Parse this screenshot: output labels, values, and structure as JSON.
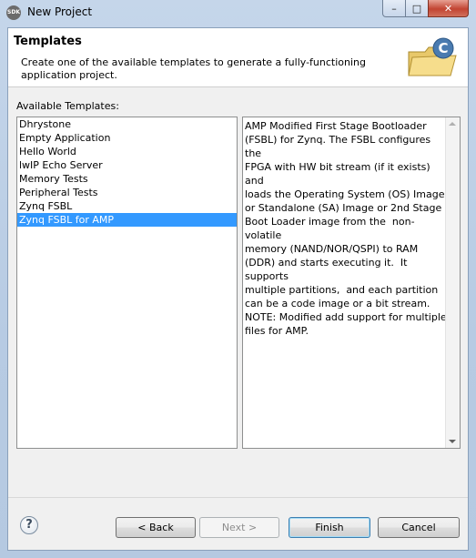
{
  "window": {
    "title": "New Project",
    "icon_label": "SDK"
  },
  "header": {
    "title": "Templates",
    "description": "Create one of the available templates to generate a fully-functioning application project."
  },
  "templates": {
    "label": "Available Templates:",
    "items": [
      "Dhrystone",
      "Empty Application",
      "Hello World",
      "lwIP Echo Server",
      "Memory Tests",
      "Peripheral Tests",
      "Zynq FSBL",
      "Zynq FSBL for AMP"
    ],
    "selected": "Zynq FSBL for AMP"
  },
  "description_panel": {
    "text": "AMP Modified First Stage Bootloader\n(FSBL) for Zynq. The FSBL configures the\nFPGA with HW bit stream (if it exists)  and\nloads the Operating System (OS) Image\nor Standalone (SA) Image or 2nd Stage\nBoot Loader image from the  non-volatile\nmemory (NAND/NOR/QSPI) to RAM\n(DDR) and starts executing it.  It supports\nmultiple partitions,  and each partition\ncan be a code image or a bit stream.\nNOTE: Modified add support for multiple\nfiles for AMP."
  },
  "buttons": {
    "help": "?",
    "back": "< Back",
    "next": "Next >",
    "finish": "Finish",
    "cancel": "Cancel"
  }
}
